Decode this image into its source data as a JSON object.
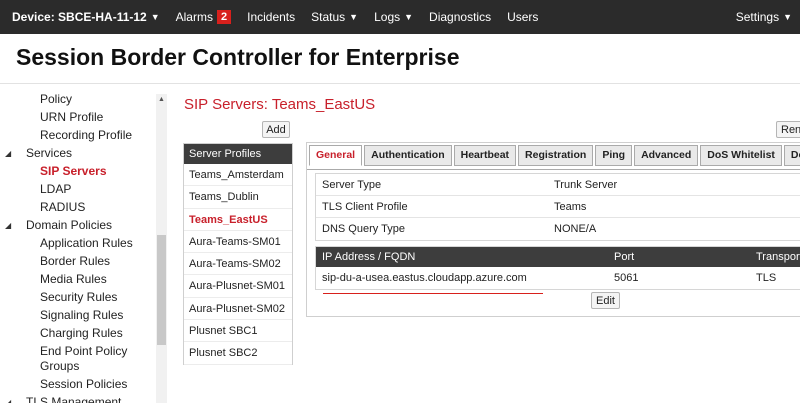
{
  "topbar": {
    "device": "Device: SBCE-HA-11-12",
    "alarms": "Alarms",
    "alarm_count": "2",
    "incidents": "Incidents",
    "status": "Status",
    "logs": "Logs",
    "diagnostics": "Diagnostics",
    "users": "Users",
    "settings": "Settings"
  },
  "page_title": "Session Border Controller for Enterprise",
  "leftnav": {
    "items": [
      {
        "label": "Policy",
        "indent": 2
      },
      {
        "label": "URN Profile",
        "indent": 2
      },
      {
        "label": "Recording Profile",
        "indent": 2
      },
      {
        "label": "Services",
        "indent": 1
      },
      {
        "label": "SIP Servers",
        "indent": 2
      },
      {
        "label": "LDAP",
        "indent": 2
      },
      {
        "label": "RADIUS",
        "indent": 2
      },
      {
        "label": "Domain Policies",
        "indent": 1
      },
      {
        "label": "Application Rules",
        "indent": 2
      },
      {
        "label": "Border Rules",
        "indent": 2
      },
      {
        "label": "Media Rules",
        "indent": 2
      },
      {
        "label": "Security Rules",
        "indent": 2
      },
      {
        "label": "Signaling Rules",
        "indent": 2
      },
      {
        "label": "Charging Rules",
        "indent": 2
      },
      {
        "label": "End Point Policy",
        "indent": 2
      },
      {
        "label": "Groups",
        "indent": 2
      },
      {
        "label": "Session Policies",
        "indent": 2
      },
      {
        "label": "TLS Management",
        "indent": 1
      }
    ]
  },
  "section_title": "SIP Servers: Teams_EastUS",
  "add_button": "Add",
  "rename_button": "Rena",
  "profiles": {
    "header": "Server Profiles",
    "items": [
      "Teams_Amsterdam",
      "Teams_Dublin",
      "Teams_EastUS",
      "Aura-Teams-SM01",
      "Aura-Teams-SM02",
      "Aura-Plusnet-SM01",
      "Aura-Plusnet-SM02",
      "Plusnet SBC1",
      "Plusnet SBC2"
    ]
  },
  "tabs": [
    "General",
    "Authentication",
    "Heartbeat",
    "Registration",
    "Ping",
    "Advanced",
    "DoS Whitelist",
    "DoS Protectio"
  ],
  "general": {
    "rows": [
      {
        "key": "Server Type",
        "value": "Trunk Server"
      },
      {
        "key": "TLS Client Profile",
        "value": "Teams"
      },
      {
        "key": "DNS Query Type",
        "value": "NONE/A"
      }
    ]
  },
  "ip_table": {
    "headers": [
      "IP Address / FQDN",
      "Port",
      "Transport"
    ],
    "rows": [
      [
        "sip-du-a-usea.eastus.cloudapp.azure.com",
        "5061",
        "TLS"
      ]
    ]
  },
  "edit_button": "Edit",
  "colors": {
    "accent": "#c8202b",
    "topbar": "#2b2b2b",
    "header": "#3d3d3d"
  }
}
